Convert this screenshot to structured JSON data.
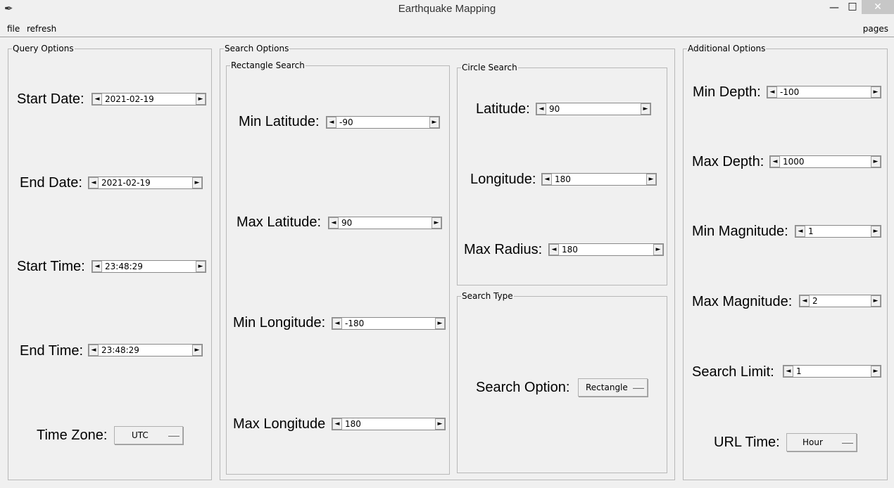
{
  "window": {
    "title": "Earthquake Mapping",
    "app_icon": "feather-icon",
    "controls": {
      "minimize": "—",
      "maximize": "□",
      "close": "✕"
    }
  },
  "menu": {
    "file": "file",
    "refresh": "refresh",
    "pages": "pages"
  },
  "query_options": {
    "title": "Query Options",
    "start_date": {
      "label": "Start Date:",
      "value": "2021-02-19"
    },
    "end_date": {
      "label": "End Date:",
      "value": "2021-02-19"
    },
    "start_time": {
      "label": "Start Time:",
      "value": "23:48:29"
    },
    "end_time": {
      "label": "End Time:",
      "value": "23:48:29"
    },
    "time_zone": {
      "label": "Time Zone:",
      "value": "UTC"
    }
  },
  "search_options": {
    "title": "Search Options",
    "rectangle": {
      "title": "Rectangle Search",
      "min_lat": {
        "label": "Min Latitude:",
        "value": "-90"
      },
      "max_lat": {
        "label": "Max Latitude:",
        "value": "90"
      },
      "min_lon": {
        "label": "Min Longitude:",
        "value": "-180"
      },
      "max_lon": {
        "label": "Max Longitude",
        "value": "180"
      }
    },
    "circle": {
      "title": "Circle Search",
      "lat": {
        "label": "Latitude:",
        "value": "90"
      },
      "lon": {
        "label": "Longitude:",
        "value": "180"
      },
      "radius": {
        "label": "Max Radius:",
        "value": "180"
      }
    },
    "search_type": {
      "title": "Search Type",
      "option": {
        "label": "Search Option:",
        "value": "Rectangle"
      }
    }
  },
  "additional_options": {
    "title": "Additional Options",
    "min_depth": {
      "label": "Min Depth:",
      "value": "-100"
    },
    "max_depth": {
      "label": "Max Depth:",
      "value": "1000"
    },
    "min_mag": {
      "label": "Min Magnitude:",
      "value": "1"
    },
    "max_mag": {
      "label": "Max Magnitude:",
      "value": "2"
    },
    "limit": {
      "label": "Search Limit:",
      "value": "1"
    },
    "url_time": {
      "label": "URL Time:",
      "value": "Hour"
    }
  },
  "icons": {
    "spin_left": "◄",
    "spin_right": "►"
  }
}
